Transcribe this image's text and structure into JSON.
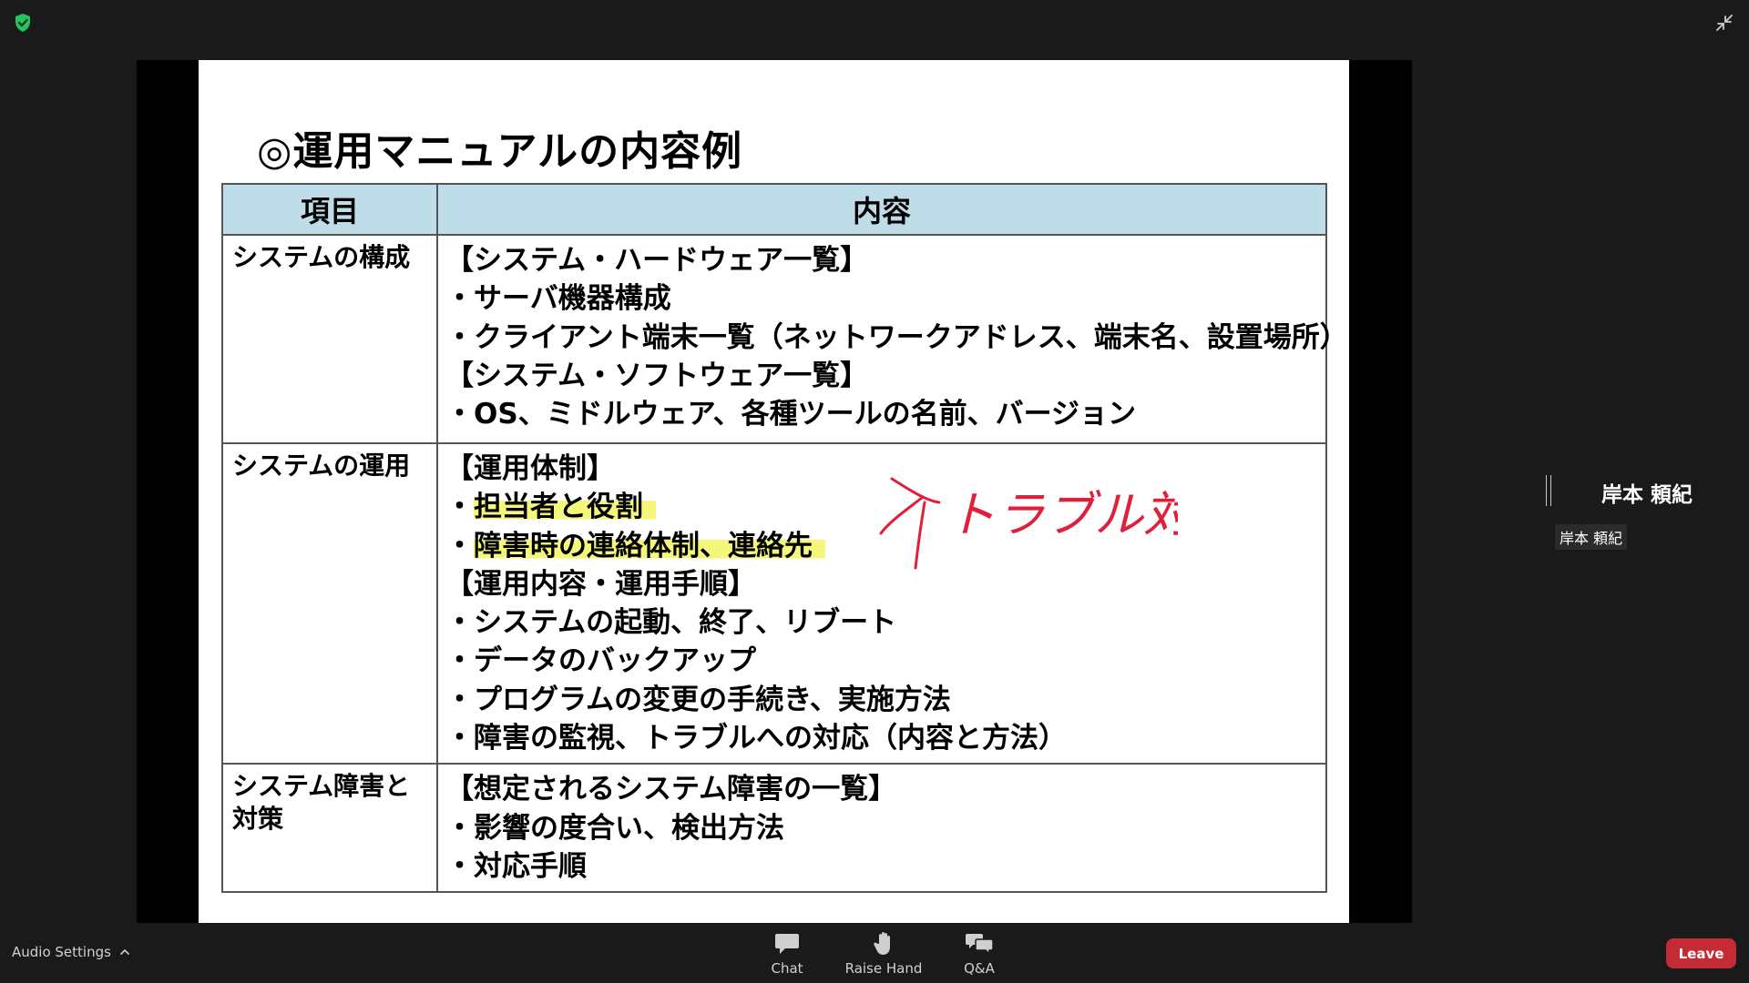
{
  "meeting": {
    "speaker_name": "岸本 頼紀",
    "speaker_label": "岸本 頼紀"
  },
  "slide": {
    "title": "◎運用マニュアルの内容例",
    "headers": [
      "項目",
      "内容"
    ],
    "rows": [
      {
        "item": "システムの構成",
        "lines": [
          "【システム・ハードウェア一覧】",
          "・サーバ機器構成",
          "・クライアント端末一覧（ネットワークアドレス、端末名、設置場所）",
          "【システム・ソフトウェア一覧】",
          "・OS、ミドルウェア、各種ツールの名前、バージョン"
        ]
      },
      {
        "item": "システムの運用",
        "lines": [
          "【運用体制】",
          "担当者と役割",
          "障害時の連絡体制、連絡先",
          "【運用内容・運用手順】",
          "・システムの起動、終了、リブート",
          "・データのバックアップ",
          "・プログラムの変更の手続き、実施方法",
          "・障害の監視、トラブルへの対応（内容と方法）"
        ],
        "bullet": "・"
      },
      {
        "item": "システム障害と対策",
        "lines": [
          "【想定されるシステム障害の一覧】",
          "・影響の度合い、検出方法",
          "・対応手順"
        ]
      }
    ],
    "annotation_text": "トラブル対応"
  },
  "toolbar": {
    "audio_settings": "Audio Settings",
    "chat": "Chat",
    "raise_hand": "Raise Hand",
    "qa": "Q&A",
    "leave": "Leave"
  },
  "colors": {
    "background": "#1a1a1a",
    "table_header": "#bfdde9",
    "highlight": "#f4f77a",
    "annotation_ink": "#e0203a",
    "leave": "#c52b35",
    "security": "#22c55e"
  },
  "icons": {
    "security": "shield-check-icon",
    "exit_fullscreen": "exit-fullscreen-icon",
    "chat": "chat-icon",
    "raise_hand": "hand-icon",
    "qa": "qa-icon",
    "caret": "caret-up-icon"
  }
}
